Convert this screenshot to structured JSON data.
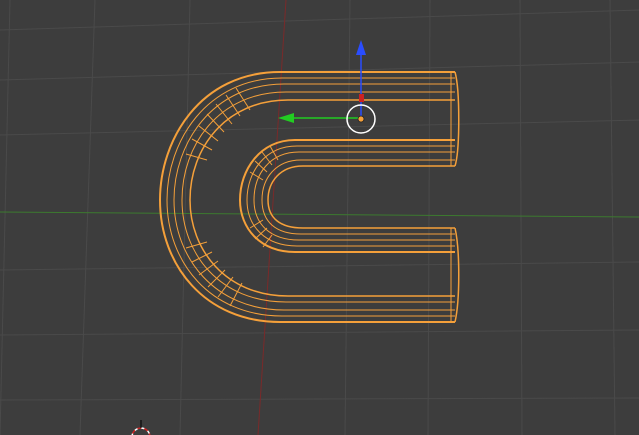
{
  "viewport": {
    "mode": "wireframe",
    "background_color": "#3d3d3d",
    "grid_color": "#4a4a4a",
    "x_axis_color": "#3c7a2f",
    "y_axis_color": "#7a2a2a",
    "object_color": "#f5a03a"
  },
  "selected_object": {
    "shape": "U-shaped tube (magnet)",
    "state": "selected"
  },
  "gizmo": {
    "z_axis_color": "#2a4dff",
    "y_axis_color": "#22cc22",
    "x_axis_color": "#cc2222"
  },
  "icons": [
    "transform-gizmo-icon",
    "object-origin-icon",
    "3d-cursor-icon"
  ]
}
